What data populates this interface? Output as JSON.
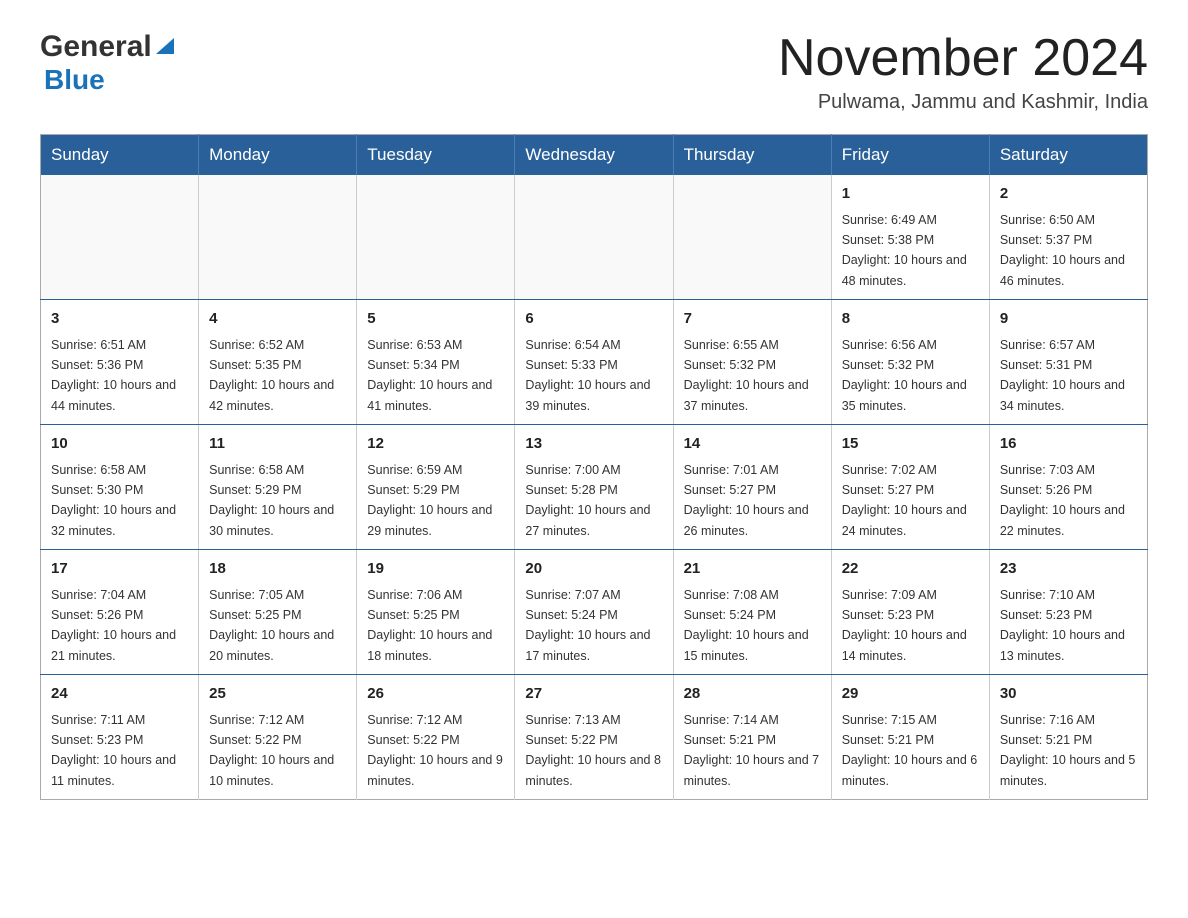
{
  "logo": {
    "general": "General",
    "blue": "Blue"
  },
  "title": {
    "month_year": "November 2024",
    "location": "Pulwama, Jammu and Kashmir, India"
  },
  "weekdays": [
    "Sunday",
    "Monday",
    "Tuesday",
    "Wednesday",
    "Thursday",
    "Friday",
    "Saturday"
  ],
  "weeks": [
    [
      {
        "day": "",
        "info": ""
      },
      {
        "day": "",
        "info": ""
      },
      {
        "day": "",
        "info": ""
      },
      {
        "day": "",
        "info": ""
      },
      {
        "day": "",
        "info": ""
      },
      {
        "day": "1",
        "info": "Sunrise: 6:49 AM\nSunset: 5:38 PM\nDaylight: 10 hours and 48 minutes."
      },
      {
        "day": "2",
        "info": "Sunrise: 6:50 AM\nSunset: 5:37 PM\nDaylight: 10 hours and 46 minutes."
      }
    ],
    [
      {
        "day": "3",
        "info": "Sunrise: 6:51 AM\nSunset: 5:36 PM\nDaylight: 10 hours and 44 minutes."
      },
      {
        "day": "4",
        "info": "Sunrise: 6:52 AM\nSunset: 5:35 PM\nDaylight: 10 hours and 42 minutes."
      },
      {
        "day": "5",
        "info": "Sunrise: 6:53 AM\nSunset: 5:34 PM\nDaylight: 10 hours and 41 minutes."
      },
      {
        "day": "6",
        "info": "Sunrise: 6:54 AM\nSunset: 5:33 PM\nDaylight: 10 hours and 39 minutes."
      },
      {
        "day": "7",
        "info": "Sunrise: 6:55 AM\nSunset: 5:32 PM\nDaylight: 10 hours and 37 minutes."
      },
      {
        "day": "8",
        "info": "Sunrise: 6:56 AM\nSunset: 5:32 PM\nDaylight: 10 hours and 35 minutes."
      },
      {
        "day": "9",
        "info": "Sunrise: 6:57 AM\nSunset: 5:31 PM\nDaylight: 10 hours and 34 minutes."
      }
    ],
    [
      {
        "day": "10",
        "info": "Sunrise: 6:58 AM\nSunset: 5:30 PM\nDaylight: 10 hours and 32 minutes."
      },
      {
        "day": "11",
        "info": "Sunrise: 6:58 AM\nSunset: 5:29 PM\nDaylight: 10 hours and 30 minutes."
      },
      {
        "day": "12",
        "info": "Sunrise: 6:59 AM\nSunset: 5:29 PM\nDaylight: 10 hours and 29 minutes."
      },
      {
        "day": "13",
        "info": "Sunrise: 7:00 AM\nSunset: 5:28 PM\nDaylight: 10 hours and 27 minutes."
      },
      {
        "day": "14",
        "info": "Sunrise: 7:01 AM\nSunset: 5:27 PM\nDaylight: 10 hours and 26 minutes."
      },
      {
        "day": "15",
        "info": "Sunrise: 7:02 AM\nSunset: 5:27 PM\nDaylight: 10 hours and 24 minutes."
      },
      {
        "day": "16",
        "info": "Sunrise: 7:03 AM\nSunset: 5:26 PM\nDaylight: 10 hours and 22 minutes."
      }
    ],
    [
      {
        "day": "17",
        "info": "Sunrise: 7:04 AM\nSunset: 5:26 PM\nDaylight: 10 hours and 21 minutes."
      },
      {
        "day": "18",
        "info": "Sunrise: 7:05 AM\nSunset: 5:25 PM\nDaylight: 10 hours and 20 minutes."
      },
      {
        "day": "19",
        "info": "Sunrise: 7:06 AM\nSunset: 5:25 PM\nDaylight: 10 hours and 18 minutes."
      },
      {
        "day": "20",
        "info": "Sunrise: 7:07 AM\nSunset: 5:24 PM\nDaylight: 10 hours and 17 minutes."
      },
      {
        "day": "21",
        "info": "Sunrise: 7:08 AM\nSunset: 5:24 PM\nDaylight: 10 hours and 15 minutes."
      },
      {
        "day": "22",
        "info": "Sunrise: 7:09 AM\nSunset: 5:23 PM\nDaylight: 10 hours and 14 minutes."
      },
      {
        "day": "23",
        "info": "Sunrise: 7:10 AM\nSunset: 5:23 PM\nDaylight: 10 hours and 13 minutes."
      }
    ],
    [
      {
        "day": "24",
        "info": "Sunrise: 7:11 AM\nSunset: 5:23 PM\nDaylight: 10 hours and 11 minutes."
      },
      {
        "day": "25",
        "info": "Sunrise: 7:12 AM\nSunset: 5:22 PM\nDaylight: 10 hours and 10 minutes."
      },
      {
        "day": "26",
        "info": "Sunrise: 7:12 AM\nSunset: 5:22 PM\nDaylight: 10 hours and 9 minutes."
      },
      {
        "day": "27",
        "info": "Sunrise: 7:13 AM\nSunset: 5:22 PM\nDaylight: 10 hours and 8 minutes."
      },
      {
        "day": "28",
        "info": "Sunrise: 7:14 AM\nSunset: 5:21 PM\nDaylight: 10 hours and 7 minutes."
      },
      {
        "day": "29",
        "info": "Sunrise: 7:15 AM\nSunset: 5:21 PM\nDaylight: 10 hours and 6 minutes."
      },
      {
        "day": "30",
        "info": "Sunrise: 7:16 AM\nSunset: 5:21 PM\nDaylight: 10 hours and 5 minutes."
      }
    ]
  ]
}
